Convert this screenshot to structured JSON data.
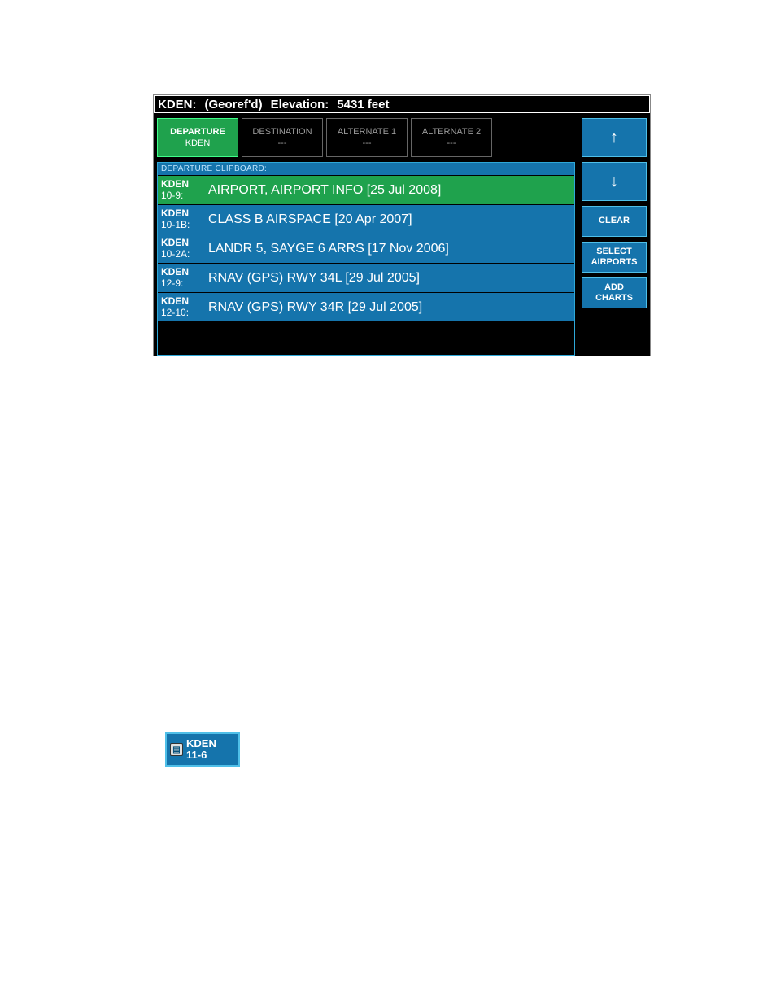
{
  "title": {
    "ident": "KDEN:",
    "georef": "(Georef'd)",
    "elev_label": "Elevation:",
    "elev_value": "5431 feet"
  },
  "tabs": [
    {
      "label": "DEPARTURE",
      "value": "KDEN",
      "active": true
    },
    {
      "label": "DESTINATION",
      "value": "---",
      "active": false
    },
    {
      "label": "ALTERNATE 1",
      "value": "---",
      "active": false
    },
    {
      "label": "ALTERNATE 2",
      "value": "---",
      "active": false
    }
  ],
  "clipboard": {
    "header": "DEPARTURE CLIPBOARD:",
    "rows": [
      {
        "code": "KDEN",
        "idx": "10-9:",
        "label": "AIRPORT, AIRPORT INFO [25 Jul 2008]",
        "selected": true
      },
      {
        "code": "KDEN",
        "idx": "10-1B:",
        "label": "CLASS B AIRSPACE [20 Apr 2007]",
        "selected": false
      },
      {
        "code": "KDEN",
        "idx": "10-2A:",
        "label": "LANDR 5, SAYGE 6 ARRS [17 Nov 2006]",
        "selected": false
      },
      {
        "code": "KDEN",
        "idx": "12-9:",
        "label": "RNAV (GPS) RWY 34L [29 Jul 2005]",
        "selected": false
      },
      {
        "code": "KDEN",
        "idx": "12-10:",
        "label": "RNAV (GPS) RWY 34R [29 Jul 2005]",
        "selected": false
      }
    ]
  },
  "side": {
    "up": "↑",
    "down": "↓",
    "clear": "CLEAR",
    "select_airports_l1": "SELECT",
    "select_airports_l2": "AIRPORTS",
    "add_charts_l1": "ADD",
    "add_charts_l2": "CHARTS"
  },
  "chip": {
    "code": "KDEN",
    "idx": "11-6"
  }
}
